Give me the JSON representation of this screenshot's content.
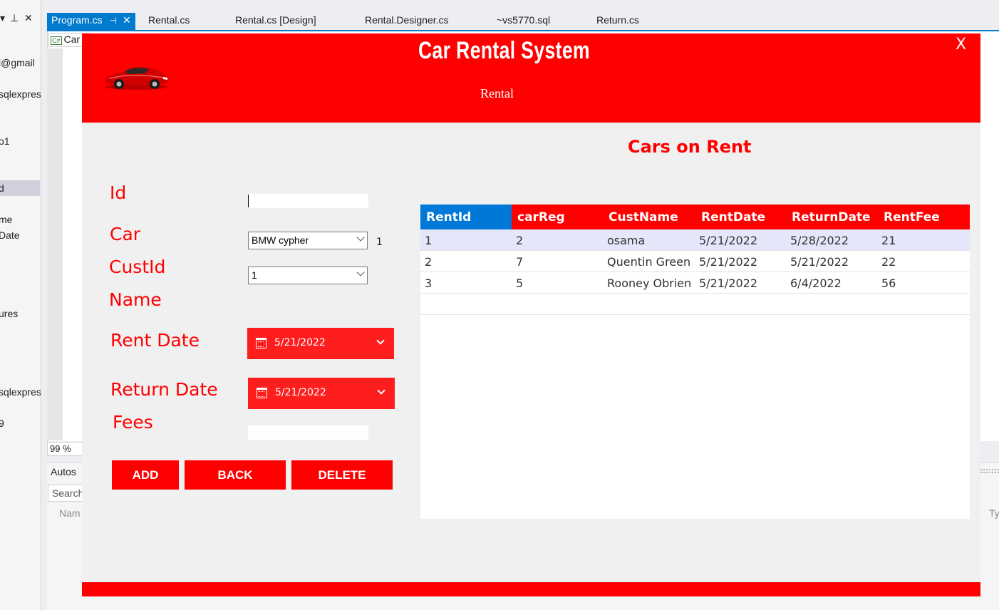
{
  "ide": {
    "tabs": [
      {
        "label": "Program.cs"
      },
      {
        "label": "Rental.cs"
      },
      {
        "label": "Rental.cs [Design]"
      },
      {
        "label": "Rental.Designer.cs"
      },
      {
        "label": "~vs5770.sql"
      },
      {
        "label": "Return.cs"
      }
    ],
    "left_panel_items": [
      "l@gmail",
      "sqlexpres",
      "o1",
      "d",
      "me",
      "Date",
      "ures",
      "sqlexpres",
      "9"
    ],
    "breadcrumb": "Car",
    "zoom": "99 %",
    "autos_label": "Autos",
    "search_placeholder": "Search",
    "name_column": "Nam",
    "type_column": "Ty"
  },
  "form": {
    "title": "Car Rental System",
    "subtitle": "Rental",
    "close": "X",
    "labels": {
      "id": "Id",
      "car": "Car",
      "cust_id": "CustId",
      "name": "Name",
      "rent_date": "Rent Date",
      "return_date": "Return Date",
      "fees": "Fees"
    },
    "fields": {
      "id_value": "",
      "car_value": "BMW cypher",
      "car_id_display": "1",
      "cust_id_value": "1",
      "rent_date": "5/21/2022",
      "return_date": "5/21/2022",
      "fees_value": ""
    },
    "buttons": {
      "add": "ADD",
      "back": "BACK",
      "delete": "DELETE"
    },
    "section_title": "Cars on Rent",
    "grid": {
      "columns": [
        "RentId",
        "carReg",
        "CustName",
        "RentDate",
        "ReturnDate",
        "RentFee"
      ],
      "rows": [
        [
          "1",
          "2",
          "osama",
          "5/21/2022",
          "5/28/2022",
          "21"
        ],
        [
          "2",
          "7",
          "Quentin Green",
          "5/21/2022",
          "5/21/2022",
          "22"
        ],
        [
          "3",
          "5",
          "Rooney Obrien",
          "5/21/2022",
          "6/4/2022",
          "56"
        ]
      ]
    }
  },
  "colors": {
    "brand_red": "#ff0000",
    "header_selected_blue": "#0078d7",
    "ide_accent": "#007acc",
    "row_selected": "#e6e6fa"
  }
}
